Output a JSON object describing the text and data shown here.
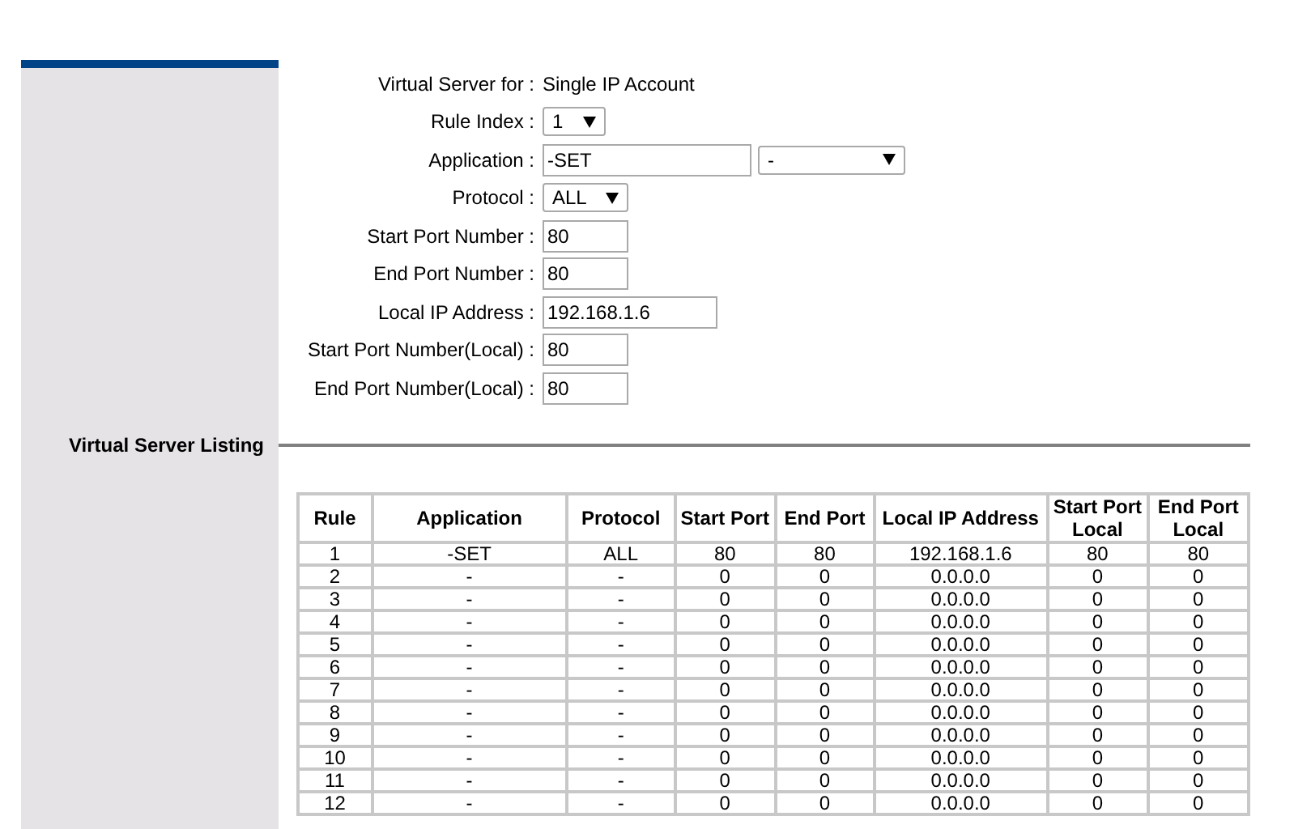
{
  "virtual_server_for": {
    "label": "Virtual Server for :",
    "value": "Single IP Account"
  },
  "fields": [
    {
      "kind": "select",
      "label": "Rule Index :",
      "value": "1"
    },
    {
      "kind": "combo",
      "label": "Application :",
      "value": "-SET",
      "option": "-"
    },
    {
      "kind": "select",
      "label": "Protocol :",
      "value": "ALL"
    },
    {
      "kind": "input",
      "label": "Start Port Number :",
      "value": "80"
    },
    {
      "kind": "input",
      "label": "End Port Number :",
      "value": "80"
    },
    {
      "kind": "wide",
      "label": "Local IP Address :",
      "value": "192.168.1.6"
    },
    {
      "kind": "input",
      "label": "Start Port Number(Local) :",
      "value": "80"
    },
    {
      "kind": "input",
      "label": "End Port Number(Local) :",
      "value": "80"
    }
  ],
  "listing": {
    "title": "Virtual Server Listing",
    "columns": [
      "Rule",
      "Application",
      "Protocol",
      "Start Port",
      "End Port",
      "Local IP Address",
      "Start Port Local",
      "End Port Local"
    ],
    "rows": [
      [
        "1",
        "-SET",
        "ALL",
        "80",
        "80",
        "192.168.1.6",
        "80",
        "80"
      ],
      [
        "2",
        "-",
        "-",
        "0",
        "0",
        "0.0.0.0",
        "0",
        "0"
      ],
      [
        "3",
        "-",
        "-",
        "0",
        "0",
        "0.0.0.0",
        "0",
        "0"
      ],
      [
        "4",
        "-",
        "-",
        "0",
        "0",
        "0.0.0.0",
        "0",
        "0"
      ],
      [
        "5",
        "-",
        "-",
        "0",
        "0",
        "0.0.0.0",
        "0",
        "0"
      ],
      [
        "6",
        "-",
        "-",
        "0",
        "0",
        "0.0.0.0",
        "0",
        "0"
      ],
      [
        "7",
        "-",
        "-",
        "0",
        "0",
        "0.0.0.0",
        "0",
        "0"
      ],
      [
        "8",
        "-",
        "-",
        "0",
        "0",
        "0.0.0.0",
        "0",
        "0"
      ],
      [
        "9",
        "-",
        "-",
        "0",
        "0",
        "0.0.0.0",
        "0",
        "0"
      ],
      [
        "10",
        "-",
        "-",
        "0",
        "0",
        "0.0.0.0",
        "0",
        "0"
      ],
      [
        "11",
        "-",
        "-",
        "0",
        "0",
        "0.0.0.0",
        "0",
        "0"
      ],
      [
        "12",
        "-",
        "-",
        "0",
        "0",
        "0.0.0.0",
        "0",
        "0"
      ]
    ]
  }
}
